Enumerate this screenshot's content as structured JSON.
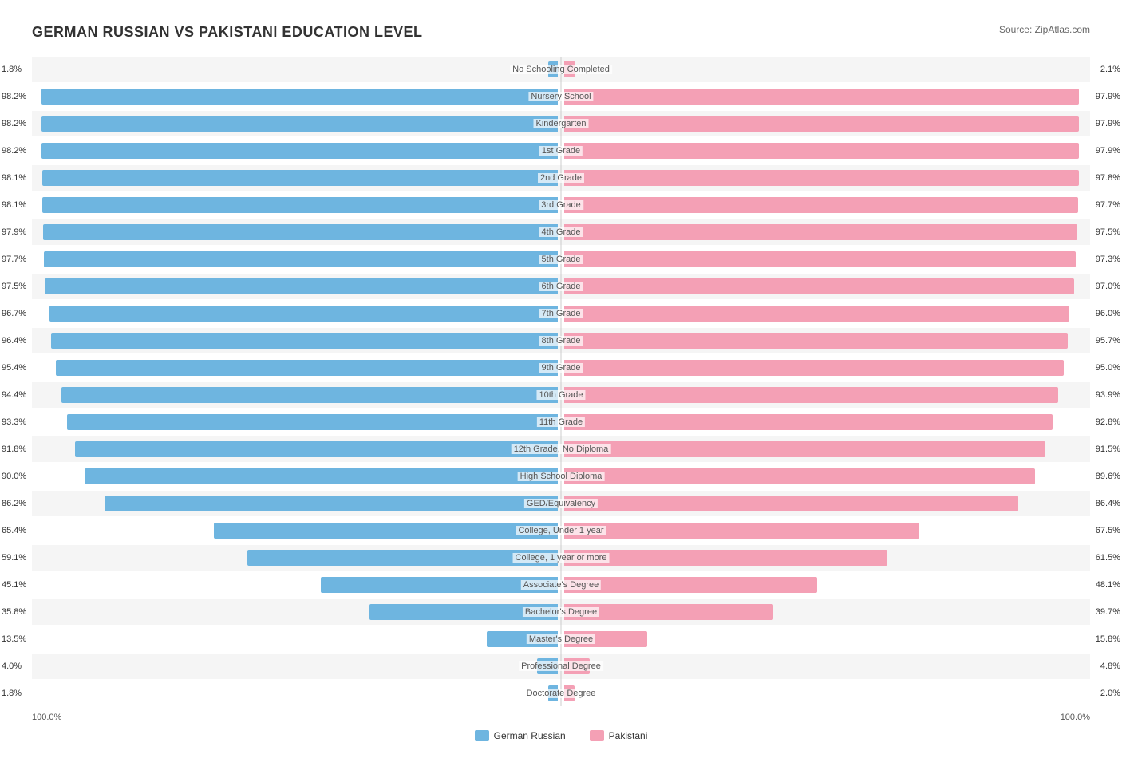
{
  "title": "GERMAN RUSSIAN VS PAKISTANI EDUCATION LEVEL",
  "source": "Source: ZipAtlas.com",
  "legend": {
    "german_russian": "German Russian",
    "pakistani": "Pakistani",
    "german_color": "#6eb5e0",
    "pakistani_color": "#f4a0b5"
  },
  "axis": {
    "left": "100.0%",
    "right": "100.0%"
  },
  "rows": [
    {
      "label": "No Schooling Completed",
      "left_val": "1.8%",
      "right_val": "2.1%",
      "left_pct": 1.8,
      "right_pct": 2.1
    },
    {
      "label": "Nursery School",
      "left_val": "98.2%",
      "right_val": "97.9%",
      "left_pct": 98.2,
      "right_pct": 97.9
    },
    {
      "label": "Kindergarten",
      "left_val": "98.2%",
      "right_val": "97.9%",
      "left_pct": 98.2,
      "right_pct": 97.9
    },
    {
      "label": "1st Grade",
      "left_val": "98.2%",
      "right_val": "97.9%",
      "left_pct": 98.2,
      "right_pct": 97.9
    },
    {
      "label": "2nd Grade",
      "left_val": "98.1%",
      "right_val": "97.8%",
      "left_pct": 98.1,
      "right_pct": 97.8
    },
    {
      "label": "3rd Grade",
      "left_val": "98.1%",
      "right_val": "97.7%",
      "left_pct": 98.1,
      "right_pct": 97.7
    },
    {
      "label": "4th Grade",
      "left_val": "97.9%",
      "right_val": "97.5%",
      "left_pct": 97.9,
      "right_pct": 97.5
    },
    {
      "label": "5th Grade",
      "left_val": "97.7%",
      "right_val": "97.3%",
      "left_pct": 97.7,
      "right_pct": 97.3
    },
    {
      "label": "6th Grade",
      "left_val": "97.5%",
      "right_val": "97.0%",
      "left_pct": 97.5,
      "right_pct": 97.0
    },
    {
      "label": "7th Grade",
      "left_val": "96.7%",
      "right_val": "96.0%",
      "left_pct": 96.7,
      "right_pct": 96.0
    },
    {
      "label": "8th Grade",
      "left_val": "96.4%",
      "right_val": "95.7%",
      "left_pct": 96.4,
      "right_pct": 95.7
    },
    {
      "label": "9th Grade",
      "left_val": "95.4%",
      "right_val": "95.0%",
      "left_pct": 95.4,
      "right_pct": 95.0
    },
    {
      "label": "10th Grade",
      "left_val": "94.4%",
      "right_val": "93.9%",
      "left_pct": 94.4,
      "right_pct": 93.9
    },
    {
      "label": "11th Grade",
      "left_val": "93.3%",
      "right_val": "92.8%",
      "left_pct": 93.3,
      "right_pct": 92.8
    },
    {
      "label": "12th Grade, No Diploma",
      "left_val": "91.8%",
      "right_val": "91.5%",
      "left_pct": 91.8,
      "right_pct": 91.5
    },
    {
      "label": "High School Diploma",
      "left_val": "90.0%",
      "right_val": "89.6%",
      "left_pct": 90.0,
      "right_pct": 89.6
    },
    {
      "label": "GED/Equivalency",
      "left_val": "86.2%",
      "right_val": "86.4%",
      "left_pct": 86.2,
      "right_pct": 86.4
    },
    {
      "label": "College, Under 1 year",
      "left_val": "65.4%",
      "right_val": "67.5%",
      "left_pct": 65.4,
      "right_pct": 67.5
    },
    {
      "label": "College, 1 year or more",
      "left_val": "59.1%",
      "right_val": "61.5%",
      "left_pct": 59.1,
      "right_pct": 61.5
    },
    {
      "label": "Associate's Degree",
      "left_val": "45.1%",
      "right_val": "48.1%",
      "left_pct": 45.1,
      "right_pct": 48.1
    },
    {
      "label": "Bachelor's Degree",
      "left_val": "35.8%",
      "right_val": "39.7%",
      "left_pct": 35.8,
      "right_pct": 39.7
    },
    {
      "label": "Master's Degree",
      "left_val": "13.5%",
      "right_val": "15.8%",
      "left_pct": 13.5,
      "right_pct": 15.8
    },
    {
      "label": "Professional Degree",
      "left_val": "4.0%",
      "right_val": "4.8%",
      "left_pct": 4.0,
      "right_pct": 4.8
    },
    {
      "label": "Doctorate Degree",
      "left_val": "1.8%",
      "right_val": "2.0%",
      "left_pct": 1.8,
      "right_pct": 2.0
    }
  ]
}
